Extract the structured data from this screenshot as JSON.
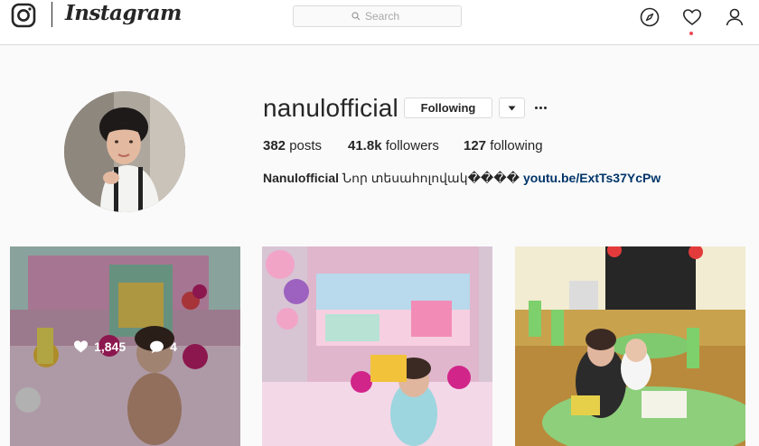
{
  "header": {
    "logo_text": "Instagram",
    "search": {
      "placeholder": "Search"
    },
    "icons": [
      "compass-icon",
      "heart-icon",
      "person-icon"
    ],
    "colors": {
      "notification_dot": "#ed4956",
      "link": "#003569",
      "border": "#dbdbdb"
    }
  },
  "profile": {
    "username": "nanulofficial",
    "follow_button_label": "Following",
    "stats": {
      "posts_count": "382",
      "posts_label": "posts",
      "followers_count": "41.8k",
      "followers_label": "followers",
      "following_count": "127",
      "following_label": "following"
    },
    "bio": {
      "full_name": "Nanulofficial",
      "text": "Նոր տեսահոլովակ����",
      "link": "youtu.be/ExtTs37YcPw"
    }
  },
  "posts": [
    {
      "likes": "1,845",
      "comments": "4",
      "hovered": true
    },
    {
      "hovered": false
    },
    {
      "hovered": false
    }
  ]
}
